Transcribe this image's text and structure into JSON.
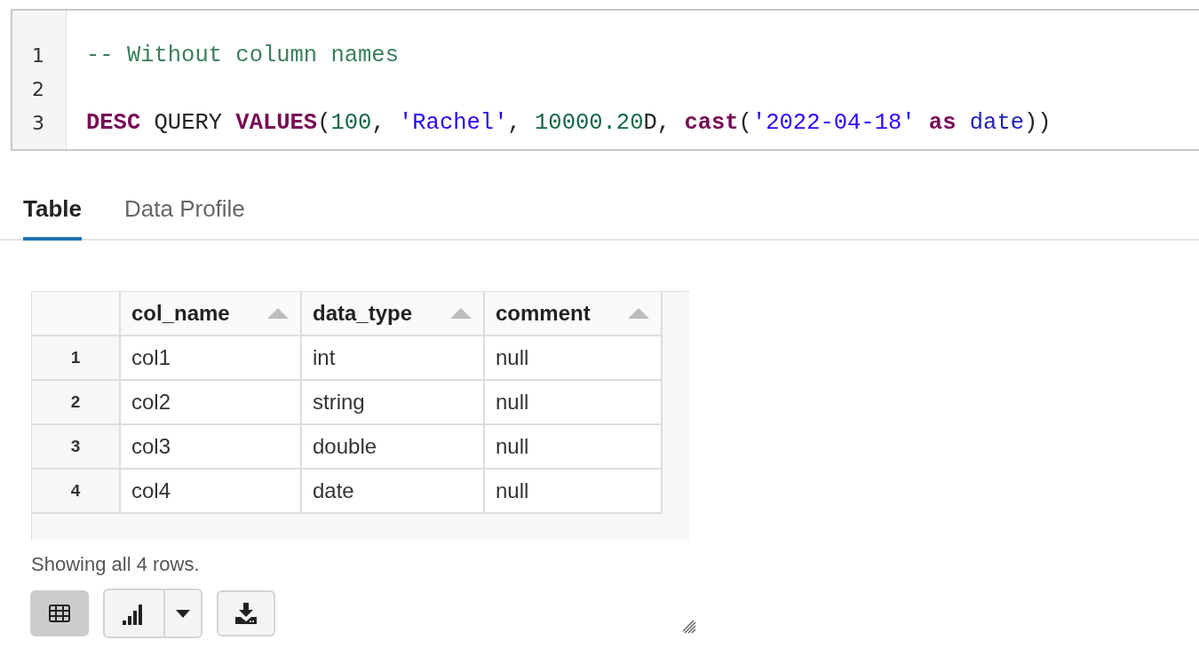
{
  "editor": {
    "lines": [
      {
        "number": "1",
        "tokens": [
          {
            "kind": "comment",
            "text": "-- Without column names"
          }
        ]
      },
      {
        "number": "2"
      },
      {
        "number": "3",
        "tokens": [
          {
            "kind": "keyword",
            "text": "DESC"
          },
          {
            "kind": "plain",
            "text": " QUERY "
          },
          {
            "kind": "keyword",
            "text": "VALUES"
          },
          {
            "kind": "plain",
            "text": "("
          },
          {
            "kind": "number",
            "text": "100"
          },
          {
            "kind": "plain",
            "text": ", "
          },
          {
            "kind": "string",
            "text": "'Rachel'"
          },
          {
            "kind": "plain",
            "text": ", "
          },
          {
            "kind": "number",
            "text": "10000.20"
          },
          {
            "kind": "plain",
            "text": "D, "
          },
          {
            "kind": "keyword",
            "text": "cast"
          },
          {
            "kind": "plain",
            "text": "("
          },
          {
            "kind": "string",
            "text": "'2022-04-18'"
          },
          {
            "kind": "keyword",
            "text": " as "
          },
          {
            "kind": "type",
            "text": "date"
          },
          {
            "kind": "plain",
            "text": "))"
          }
        ]
      }
    ]
  },
  "tabs": [
    {
      "label": "Table",
      "selected": true
    },
    {
      "label": "Data Profile",
      "selected": false
    }
  ],
  "table": {
    "columns": [
      "col_name",
      "data_type",
      "comment"
    ],
    "rows": [
      {
        "index": "1",
        "cells": [
          "col1",
          "int",
          "null"
        ]
      },
      {
        "index": "2",
        "cells": [
          "col2",
          "string",
          "null"
        ]
      },
      {
        "index": "3",
        "cells": [
          "col3",
          "double",
          "null"
        ]
      },
      {
        "index": "4",
        "cells": [
          "col4",
          "date",
          "null"
        ]
      }
    ]
  },
  "footer": {
    "summary": "Showing all 4 rows."
  },
  "toolbar": [
    {
      "kind": "table",
      "selected": true
    },
    {
      "kind": "chart",
      "selected": false
    },
    {
      "kind": "download",
      "selected": false
    }
  ]
}
